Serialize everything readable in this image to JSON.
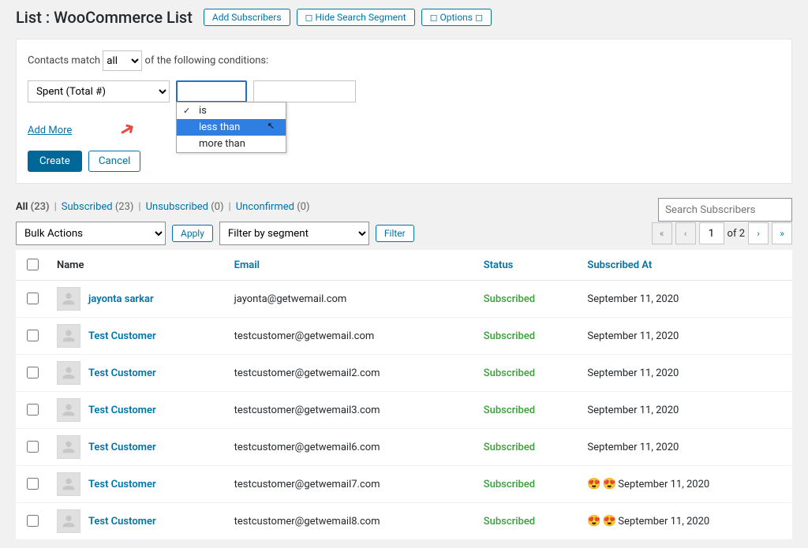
{
  "header": {
    "title": "List : WooCommerce List",
    "add": "Add Subscribers",
    "hide": "◻ Hide Search Segment",
    "options": "◻ Options ◻"
  },
  "segment": {
    "match_label_pre": "Contacts match",
    "match_select": "all",
    "match_label_post": "of the following conditions:",
    "field_select": "Spent (Total #)",
    "dropdown": {
      "is": "is",
      "less": "less than",
      "more": "more than"
    },
    "add_more": "Add More",
    "create": "Create",
    "cancel": "Cancel"
  },
  "filters": {
    "all": "All",
    "all_n": "(23)",
    "sub": "Subscribed",
    "sub_n": "(23)",
    "unsub": "Unsubscribed",
    "unsub_n": "(0)",
    "unconf": "Unconfirmed",
    "unconf_n": "(0)"
  },
  "search_placeholder": "Search Subscribers",
  "toolbar": {
    "bulk": "Bulk Actions",
    "apply": "Apply",
    "filter_seg": "Filter by segment",
    "filter": "Filter",
    "page_current": "1",
    "page_total": "of 2"
  },
  "columns": {
    "name": "Name",
    "email": "Email",
    "status": "Status",
    "subat": "Subscribed At"
  },
  "rows": [
    {
      "name": "jayonta sarkar",
      "email": "jayonta@getwemail.com",
      "status": "Subscribed",
      "date": "September 11, 2020",
      "emoji": false
    },
    {
      "name": "Test Customer",
      "email": "testcustomer@getwemail.com",
      "status": "Subscribed",
      "date": "September 11, 2020",
      "emoji": false
    },
    {
      "name": "Test Customer",
      "email": "testcustomer@getwemail2.com",
      "status": "Subscribed",
      "date": "September 11, 2020",
      "emoji": false
    },
    {
      "name": "Test Customer",
      "email": "testcustomer@getwemail3.com",
      "status": "Subscribed",
      "date": "September 11, 2020",
      "emoji": false
    },
    {
      "name": "Test Customer",
      "email": "testcustomer@getwemail6.com",
      "status": "Subscribed",
      "date": "September 11, 2020",
      "emoji": false
    },
    {
      "name": "Test Customer",
      "email": "testcustomer@getwemail7.com",
      "status": "Subscribed",
      "date": "September 11, 2020",
      "emoji": true
    },
    {
      "name": "Test Customer",
      "email": "testcustomer@getwemail8.com",
      "status": "Subscribed",
      "date": "September 11, 2020",
      "emoji": true
    }
  ]
}
